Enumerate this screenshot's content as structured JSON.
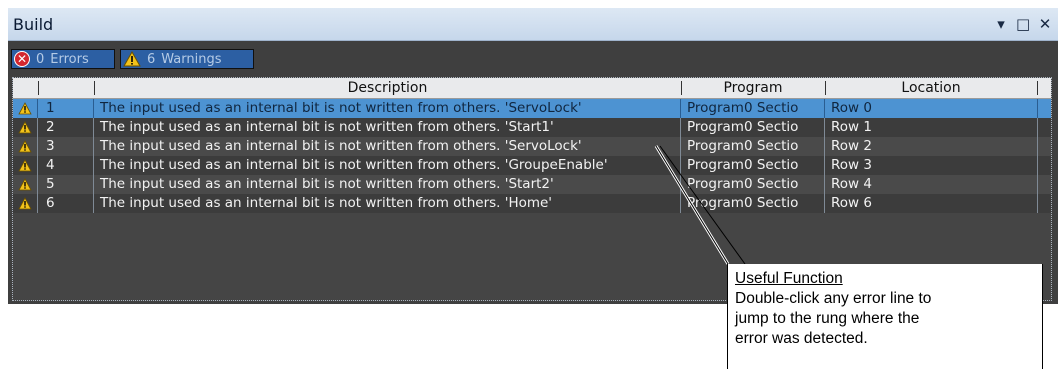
{
  "panel": {
    "title": "Build",
    "controls": [
      {
        "name": "dropdown-icon",
        "glyph": "▾"
      },
      {
        "name": "maximize-icon",
        "glyph": "□"
      },
      {
        "name": "close-icon",
        "glyph": "✕"
      }
    ]
  },
  "filters": {
    "errors": {
      "count": "0",
      "label": "Errors"
    },
    "warnings": {
      "count": "6",
      "label": "Warnings"
    }
  },
  "columns": {
    "description": "Description",
    "program": "Program",
    "location": "Location"
  },
  "rows": [
    {
      "num": "1",
      "description": "The input used as an internal bit is not written from others. 'ServoLock'",
      "program": "Program0 Sectio",
      "location": "Row 0"
    },
    {
      "num": "2",
      "description": "The input used as an internal bit is not written from others. 'Start1'",
      "program": "Program0 Sectio",
      "location": "Row 1"
    },
    {
      "num": "3",
      "description": "The input used as an internal bit is not written from others. 'ServoLock'",
      "program": "Program0 Sectio",
      "location": "Row 2"
    },
    {
      "num": "4",
      "description": "The input used as an internal bit is not written from others. 'GroupeEnable'",
      "program": "Program0 Sectio",
      "location": "Row 3"
    },
    {
      "num": "5",
      "description": "The input used as an internal bit is not written from others. 'Start2'",
      "program": "Program0 Sectio",
      "location": "Row 4"
    },
    {
      "num": "6",
      "description": "The input used as an internal bit is not written from others. 'Home'",
      "program": "Program0 Sectio",
      "location": "Row 6"
    }
  ],
  "callout": {
    "title": "Useful Function",
    "line1": "Double-click any error line to",
    "line2": "jump to the rung where the",
    "line3": "error was detected."
  },
  "colors": {
    "selected_row": "#4d93d2",
    "warning": "#f2c21a",
    "error": "#d3272f",
    "filter_button": "#2c5fa3"
  }
}
